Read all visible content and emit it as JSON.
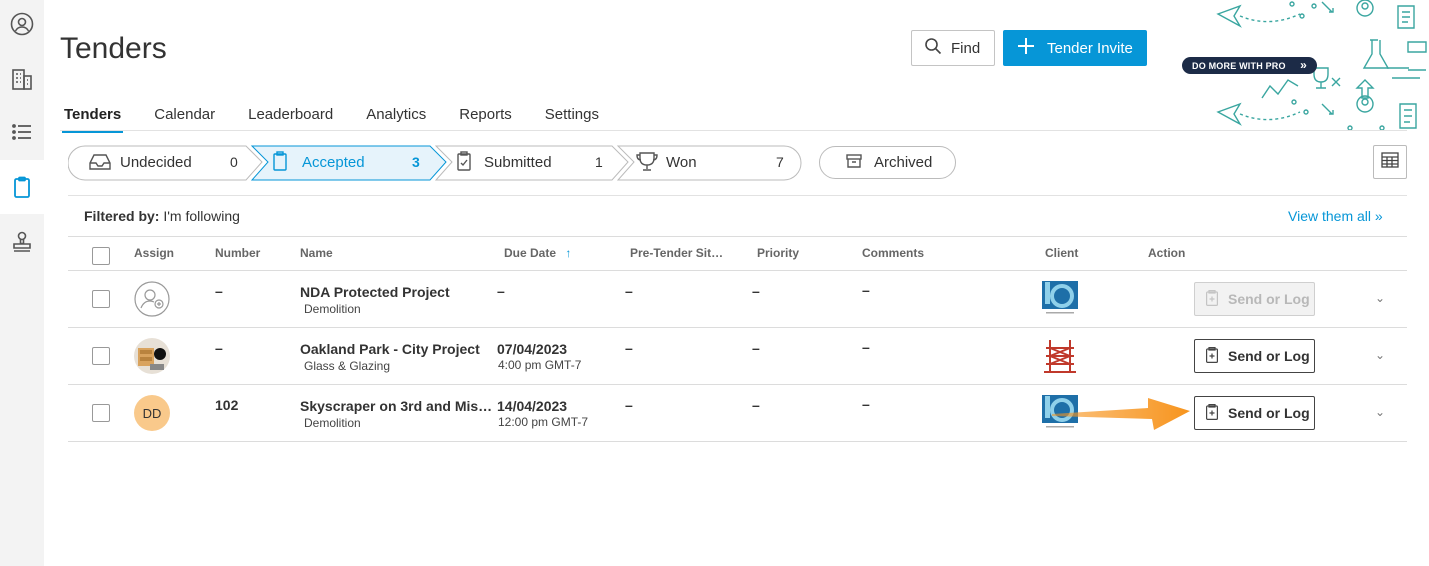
{
  "app": {
    "title": "Tenders"
  },
  "header": {
    "find_label": "Find",
    "invite_label": "Tender Invite",
    "promo_label": "DO MORE WITH PRO"
  },
  "tabs": [
    {
      "label": "Tenders",
      "active": true
    },
    {
      "label": "Calendar"
    },
    {
      "label": "Leaderboard"
    },
    {
      "label": "Analytics"
    },
    {
      "label": "Reports"
    },
    {
      "label": "Settings"
    }
  ],
  "status": [
    {
      "label": "Undecided",
      "count": "0",
      "icon": "inbox-icon"
    },
    {
      "label": "Accepted",
      "count": "3",
      "icon": "clipboard-icon",
      "active": true
    },
    {
      "label": "Submitted",
      "count": "1",
      "icon": "clipboard-check-icon"
    },
    {
      "label": "Won",
      "count": "7",
      "icon": "trophy-icon"
    }
  ],
  "archived_label": "Archived",
  "filter": {
    "prefix": "Filtered by:",
    "value": "I'm following",
    "view_all": "View them all »"
  },
  "table": {
    "headers": [
      "Assign",
      "Number",
      "Name",
      "Due Date",
      "Pre-Tender Sit…",
      "Priority",
      "Comments",
      "Client",
      "Action"
    ],
    "rows": [
      {
        "assign": "unassigned",
        "number": "–",
        "name": "NDA Protected Project",
        "trade": "Demolition",
        "due_date": "–",
        "due_time": "",
        "pre_tender": "–",
        "priority": "–",
        "comments": "–",
        "action": "Send or Log",
        "action_enabled": false
      },
      {
        "assign": "photo",
        "number": "–",
        "name": "Oakland Park - City Project",
        "trade": "Glass & Glazing",
        "due_date": "07/04/2023",
        "due_time": "4:00 pm GMT-7",
        "pre_tender": "–",
        "priority": "–",
        "comments": "–",
        "action": "Send or Log",
        "action_enabled": true
      },
      {
        "assign": "DD",
        "number": "102",
        "name": "Skyscraper on 3rd and Mis…",
        "trade": "Demolition",
        "due_date": "14/04/2023",
        "due_time": "12:00 pm GMT-7",
        "pre_tender": "–",
        "priority": "–",
        "comments": "–",
        "action": "Send or Log",
        "action_enabled": true
      }
    ]
  },
  "colors": {
    "accent": "#0696d7",
    "annotation_arrow": "#f7941d",
    "promo_teal": "#3aa6a0"
  }
}
